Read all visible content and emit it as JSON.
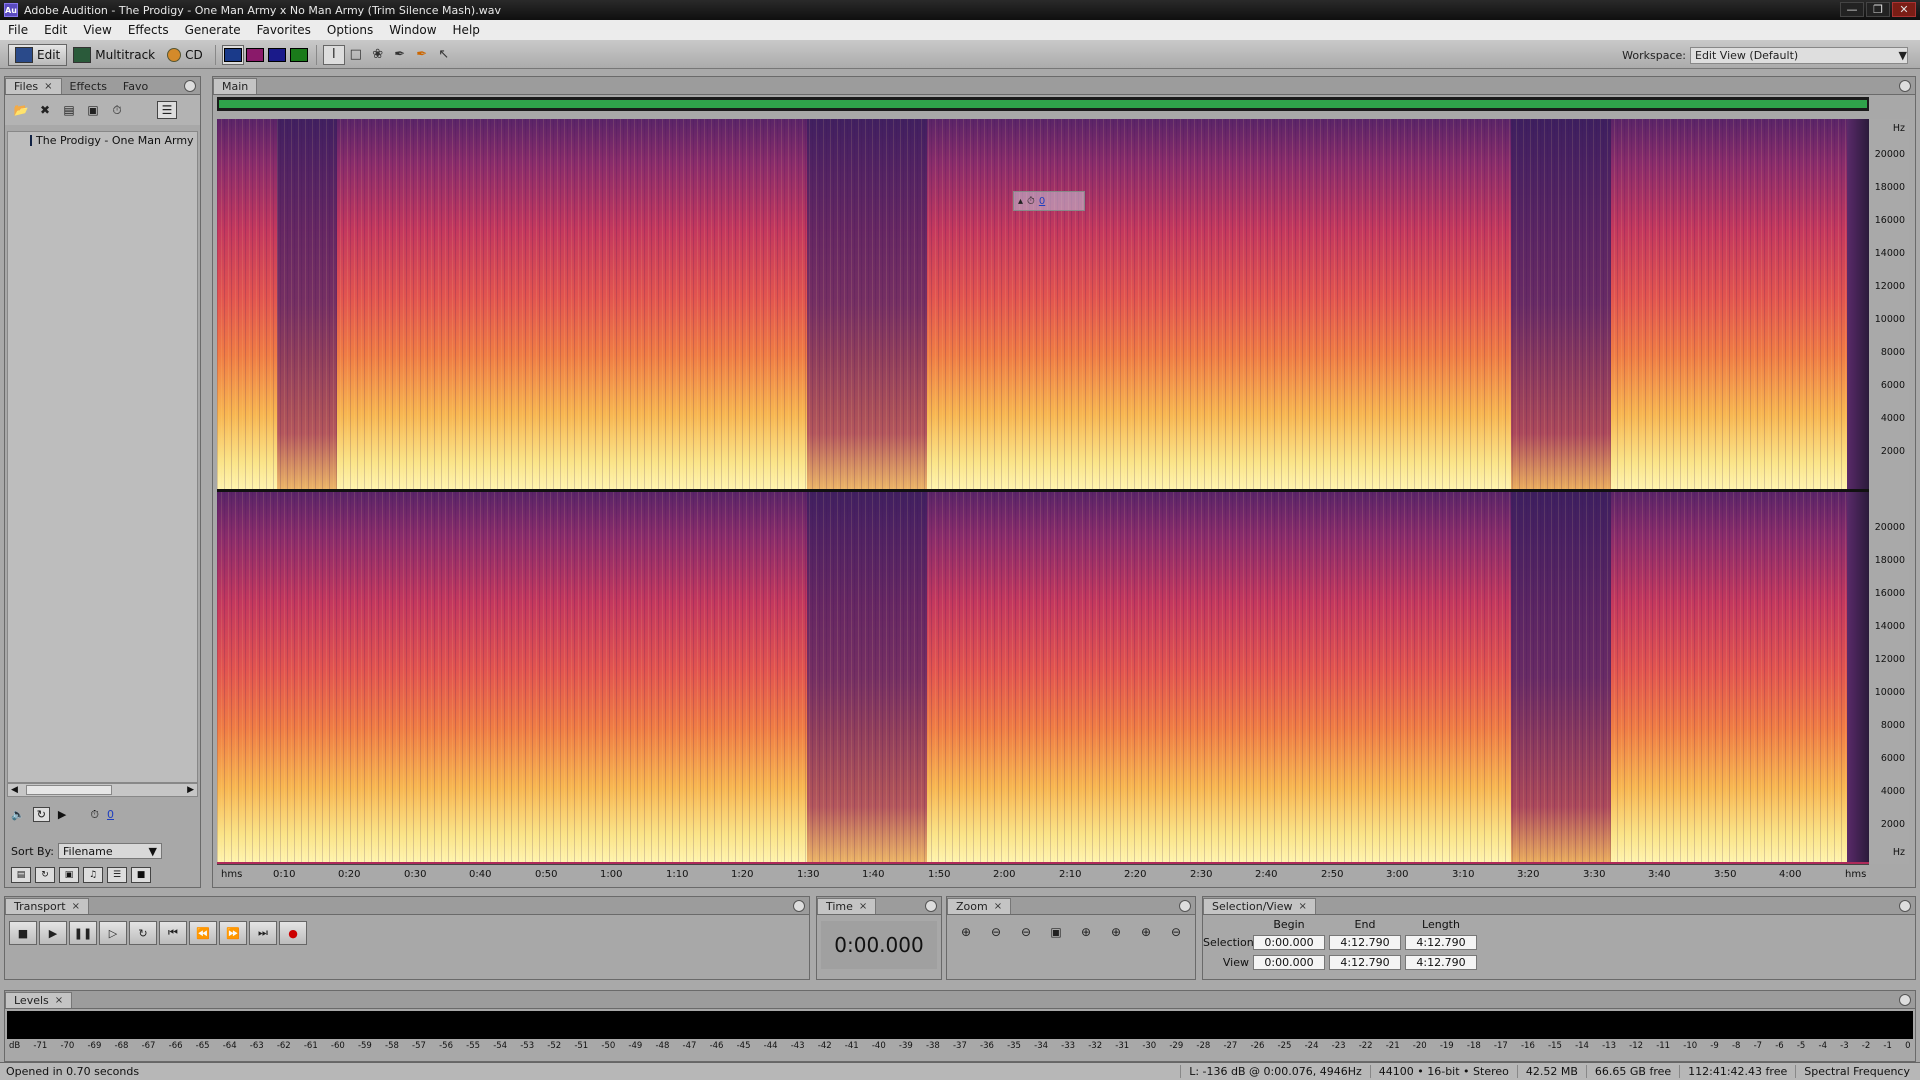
{
  "window": {
    "title": "Adobe Audition - The Prodigy - One Man Army x No Man Army (Trim Silence Mash).wav",
    "icon_text": "Au"
  },
  "menu": [
    "File",
    "Edit",
    "View",
    "Effects",
    "Generate",
    "Favorites",
    "Options",
    "Window",
    "Help"
  ],
  "toolbar": {
    "edit": "Edit",
    "multitrack": "Multitrack",
    "cd": "CD",
    "workspace_label": "Workspace:",
    "workspace_value": "Edit View (Default)"
  },
  "files_panel": {
    "tabs": [
      "Files",
      "Effects",
      "Favo"
    ],
    "items": [
      "The Prodigy - One Man Army x No Man Army (Trim Silence Mash).wav"
    ],
    "sort_label": "Sort By:",
    "sort_value": "Filename",
    "volume_value": "0"
  },
  "main": {
    "tab": "Main",
    "zoom_value": "0",
    "hz_labels": [
      "Hz",
      "20000",
      "18000",
      "16000",
      "14000",
      "12000",
      "10000",
      "8000",
      "6000",
      "4000",
      "2000"
    ],
    "time_labels": [
      "hms",
      "0:10",
      "0:20",
      "0:30",
      "0:40",
      "0:50",
      "1:00",
      "1:10",
      "1:20",
      "1:30",
      "1:40",
      "1:50",
      "2:00",
      "2:10",
      "2:20",
      "2:30",
      "2:40",
      "2:50",
      "3:00",
      "3:10",
      "3:20",
      "3:30",
      "3:40",
      "3:50",
      "4:00",
      "hms"
    ]
  },
  "transport": {
    "tab": "Transport"
  },
  "time": {
    "tab": "Time",
    "value": "0:00.000"
  },
  "zoom": {
    "tab": "Zoom"
  },
  "selview": {
    "tab": "Selection/View",
    "headers": [
      "Begin",
      "End",
      "Length"
    ],
    "selection_label": "Selection",
    "view_label": "View",
    "selection": [
      "0:00.000",
      "4:12.790",
      "4:12.790"
    ],
    "view": [
      "0:00.000",
      "4:12.790",
      "4:12.790"
    ]
  },
  "levels": {
    "tab": "Levels",
    "scale": [
      "dB",
      "-71",
      "-70",
      "-69",
      "-68",
      "-67",
      "-66",
      "-65",
      "-64",
      "-63",
      "-62",
      "-61",
      "-60",
      "-59",
      "-58",
      "-57",
      "-56",
      "-55",
      "-54",
      "-53",
      "-52",
      "-51",
      "-50",
      "-49",
      "-48",
      "-47",
      "-46",
      "-45",
      "-44",
      "-43",
      "-42",
      "-41",
      "-40",
      "-39",
      "-38",
      "-37",
      "-36",
      "-35",
      "-34",
      "-33",
      "-32",
      "-31",
      "-30",
      "-29",
      "-28",
      "-27",
      "-26",
      "-25",
      "-24",
      "-23",
      "-22",
      "-21",
      "-20",
      "-19",
      "-18",
      "-17",
      "-16",
      "-15",
      "-14",
      "-13",
      "-12",
      "-11",
      "-10",
      "-9",
      "-8",
      "-7",
      "-6",
      "-5",
      "-4",
      "-3",
      "-2",
      "-1",
      "0"
    ]
  },
  "status": {
    "left": "Opened in 0.70 seconds",
    "cursor": "L: -136 dB @  0:00.076, 4946Hz",
    "format": "44100 • 16-bit • Stereo",
    "size": "42.52 MB",
    "free": "66.65 GB free",
    "time_free": "112:41:42.43 free",
    "view": "Spectral Frequency"
  }
}
